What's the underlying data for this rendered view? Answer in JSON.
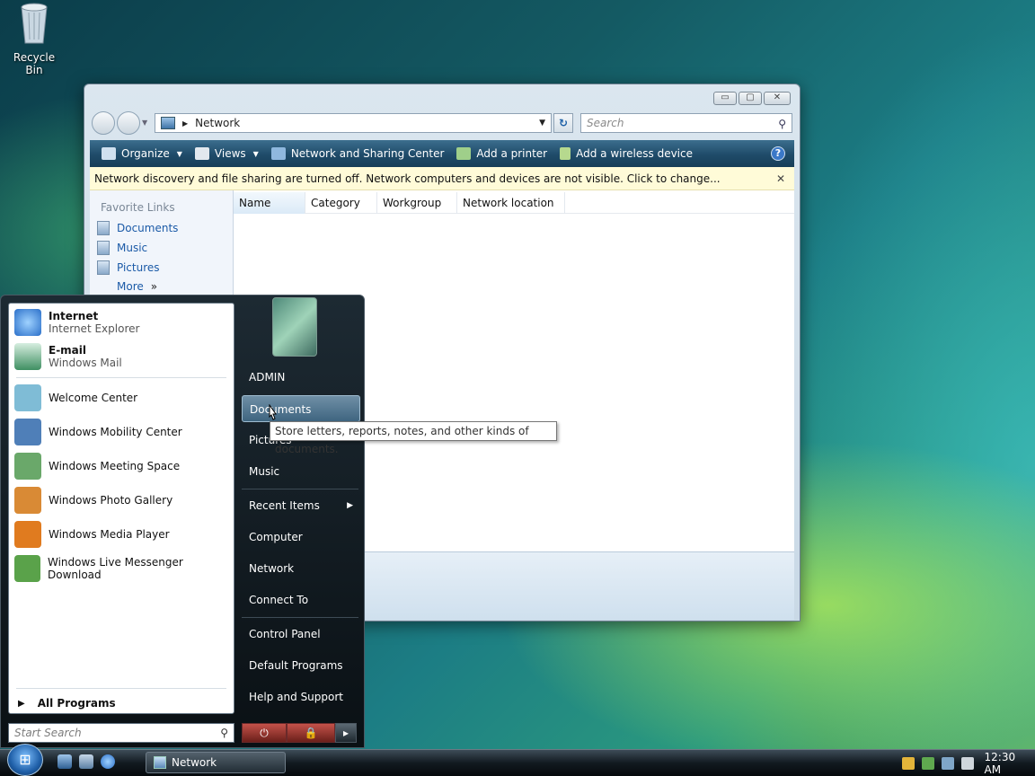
{
  "desktop": {
    "recycle_bin_label": "Recycle Bin"
  },
  "explorer": {
    "window_buttons": {
      "minimize": "▭",
      "maximize": "▢",
      "close": "✕"
    },
    "address": "Network",
    "search_placeholder": "Search",
    "toolbar": {
      "organize": "Organize",
      "views": "Views",
      "network_sharing": "Network and Sharing Center",
      "add_printer": "Add a printer",
      "add_wireless": "Add a wireless device",
      "help": "?"
    },
    "infobar_text": "Network discovery and file sharing are turned off. Network computers and devices are not visible. Click to change...",
    "infobar_close": "✕",
    "nav": {
      "heading": "Favorite Links",
      "links": [
        "Documents",
        "Music",
        "Pictures"
      ],
      "more": "More",
      "more_chevron": "»"
    },
    "columns": [
      "Name",
      "Category",
      "Workgroup",
      "Network location"
    ]
  },
  "start_menu": {
    "pinned": [
      {
        "title": "Internet",
        "sub": "Internet Explorer",
        "icon": "ie-icon",
        "color": "#2a6fc9"
      },
      {
        "title": "E-mail",
        "sub": "Windows Mail",
        "icon": "mail-icon",
        "color": "#3f8f62"
      }
    ],
    "recent": [
      {
        "label": "Welcome Center",
        "icon": "welcome-icon",
        "color": "#7fbcd6"
      },
      {
        "label": "Windows Mobility Center",
        "icon": "mobility-icon",
        "color": "#4f7fb8"
      },
      {
        "label": "Windows Meeting Space",
        "icon": "meeting-icon",
        "color": "#6aa86a"
      },
      {
        "label": "Windows Photo Gallery",
        "icon": "photo-gallery-icon",
        "color": "#d98a35"
      },
      {
        "label": "Windows Media Player",
        "icon": "media-player-icon",
        "color": "#e07b1f"
      },
      {
        "label": "Windows Live Messenger Download",
        "icon": "messenger-icon",
        "color": "#5aa24a"
      }
    ],
    "all_programs": "All Programs",
    "search_placeholder": "Start Search",
    "right": {
      "user": "ADMIN",
      "items_top": [
        "Documents",
        "Pictures",
        "Music"
      ],
      "recent_items": "Recent Items",
      "items_mid": [
        "Computer",
        "Network",
        "Connect To"
      ],
      "items_bottom": [
        "Control Panel",
        "Default Programs",
        "Help and Support"
      ]
    },
    "power_icons": {
      "power": "⏻",
      "lock": "🔒",
      "arrow": "▸"
    },
    "tooltip": "Store letters, reports, notes, and other kinds of documents."
  },
  "taskbar": {
    "start_glyph": "⊞",
    "task_label": "Network",
    "clock": "12:30 AM"
  }
}
